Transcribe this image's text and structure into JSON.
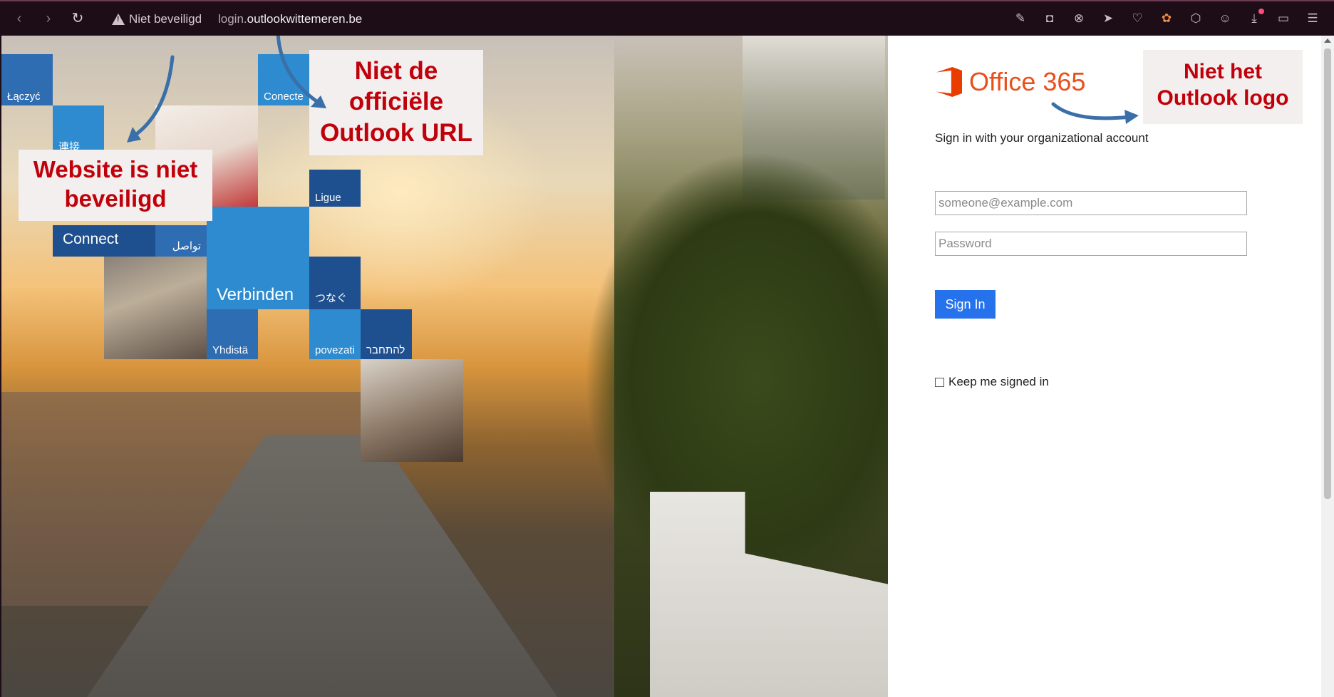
{
  "browser": {
    "back_icon": "chevron-left-icon",
    "forward_icon": "chevron-right-icon",
    "reload_icon": "reload-icon",
    "security_label": "Niet beveiligd",
    "url_prefix": "login.",
    "url_domain": "outlookwittemeren.be",
    "toolbar_icons": [
      "edit-icon",
      "camera-icon",
      "close-circle-icon",
      "send-icon",
      "heart-icon",
      "color-wheel-icon",
      "cube-icon",
      "profile-icon",
      "download-icon",
      "battery-icon",
      "menu-icon"
    ]
  },
  "hero": {
    "tiles": [
      "Łączyć",
      "Conecte",
      "連接",
      "Ligue",
      "Connect",
      "تواصل",
      "Verbinden",
      "つなぐ",
      "Yhdistä",
      "povezati",
      "להתחבר"
    ]
  },
  "annotations": {
    "insecure_site": "Website is niet beveiligd",
    "official_url_1": "Niet de",
    "official_url_2": "officiële",
    "official_url_3": "Outlook URL",
    "logo_1": "Niet het",
    "logo_2": "Outlook logo",
    "arrow_color": "#3a6fa8"
  },
  "login": {
    "logo_text": "Office 365",
    "subtitle": "Sign in with your organizational account",
    "email_placeholder": "someone@example.com",
    "password_placeholder": "Password",
    "signin_label": "Sign In",
    "keep_signed_in": "Keep me signed in"
  },
  "colors": {
    "accent": "#2672ec",
    "office_orange": "#eb3c00",
    "callout_text": "#c0000a"
  }
}
